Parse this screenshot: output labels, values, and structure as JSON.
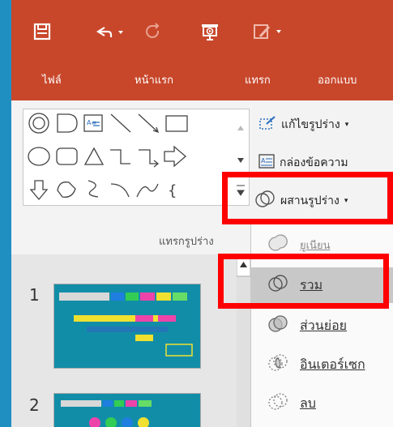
{
  "quick_access": {
    "save_icon": "save-icon",
    "undo_icon": "undo-icon",
    "redo_icon": "redo-icon",
    "present_icon": "present-from-start-icon",
    "draw_icon": "draw-icon"
  },
  "tabs": [
    "ไฟล์",
    "หน้าแรก",
    "แทรก",
    "ออกแบบ"
  ],
  "ribbon": {
    "edit_shape": "แก้ไขรูปร่าง",
    "text_box": "กล่องข้อความ",
    "merge_shapes": "ผสานรูปร่าง",
    "insert_shapes_label": "แทรกรูปร่าง"
  },
  "slides": [
    {
      "number": "1"
    },
    {
      "number": "2"
    }
  ],
  "merge_menu": {
    "items": [
      {
        "label": "ยูเนียน",
        "icon": "union-icon"
      },
      {
        "label": "รวม",
        "icon": "combine-icon",
        "highlighted": true
      },
      {
        "label": "ส่วนย่อย",
        "icon": "fragment-icon"
      },
      {
        "label": "อินเตอร์เซก",
        "icon": "intersect-icon"
      },
      {
        "label": "ลบ",
        "icon": "subtract-icon"
      }
    ]
  },
  "colors": {
    "accent": "#c8472b",
    "highlight": "#ff0000",
    "background": "#1f8fc2"
  }
}
